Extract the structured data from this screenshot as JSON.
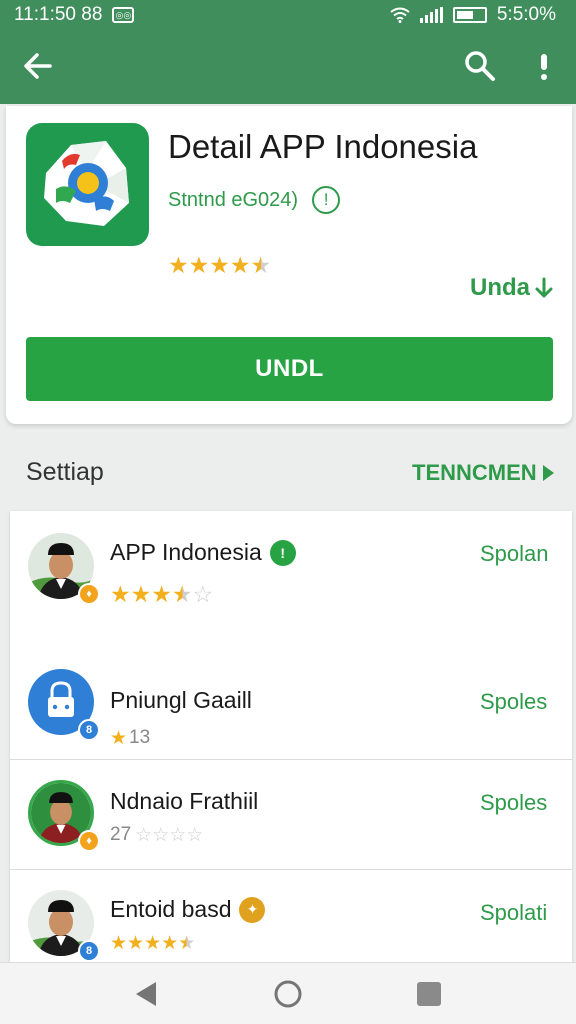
{
  "status_bar": {
    "time": "11:1:50 88",
    "battery": "5:5:0%",
    "icons": [
      "notification-icon",
      "wifi-icon",
      "signal-icon",
      "battery-icon"
    ]
  },
  "app_bar": {
    "icons": [
      "back-arrow-icon",
      "search-icon",
      "more-vert-icon"
    ]
  },
  "app": {
    "title": "Detail APP Indonesia",
    "subtitle": "Stntnd eG024)",
    "info_glyph": "!",
    "rating": 4.5,
    "secondary_action": "Unda",
    "secondary_action_icon": "download-arrow-icon",
    "install_label": "UNDL"
  },
  "section": {
    "title": "Settiap",
    "more_label": "TENNCMEN",
    "more_icon": "chevron-right-icon"
  },
  "reviews": [
    {
      "name": "APP Indonesia",
      "verified": true,
      "verify_glyph": "!",
      "stars": 3.5,
      "count": "",
      "action": "Spolan"
    },
    {
      "name": "Pniungl Gaaill",
      "verified": false,
      "verify_glyph": "",
      "stars": 1,
      "count": "13",
      "action": "Spoles"
    },
    {
      "name": "Ndnaio Frathiil",
      "verified": false,
      "verify_glyph": "",
      "stars": 0,
      "count": "27",
      "action": "Spoles"
    },
    {
      "name": "Entoid basd",
      "verified": true,
      "verify_glyph": "✦",
      "stars": 4.5,
      "count": "",
      "action": "Spolati"
    }
  ],
  "nav": {
    "icons": [
      "back-triangle-icon",
      "home-circle-icon",
      "recents-square-icon"
    ]
  },
  "colors": {
    "brand_green": "#3f8e5c",
    "accent_green": "#27a344",
    "link_green": "#2e9a4a",
    "star": "#f2b01e"
  }
}
